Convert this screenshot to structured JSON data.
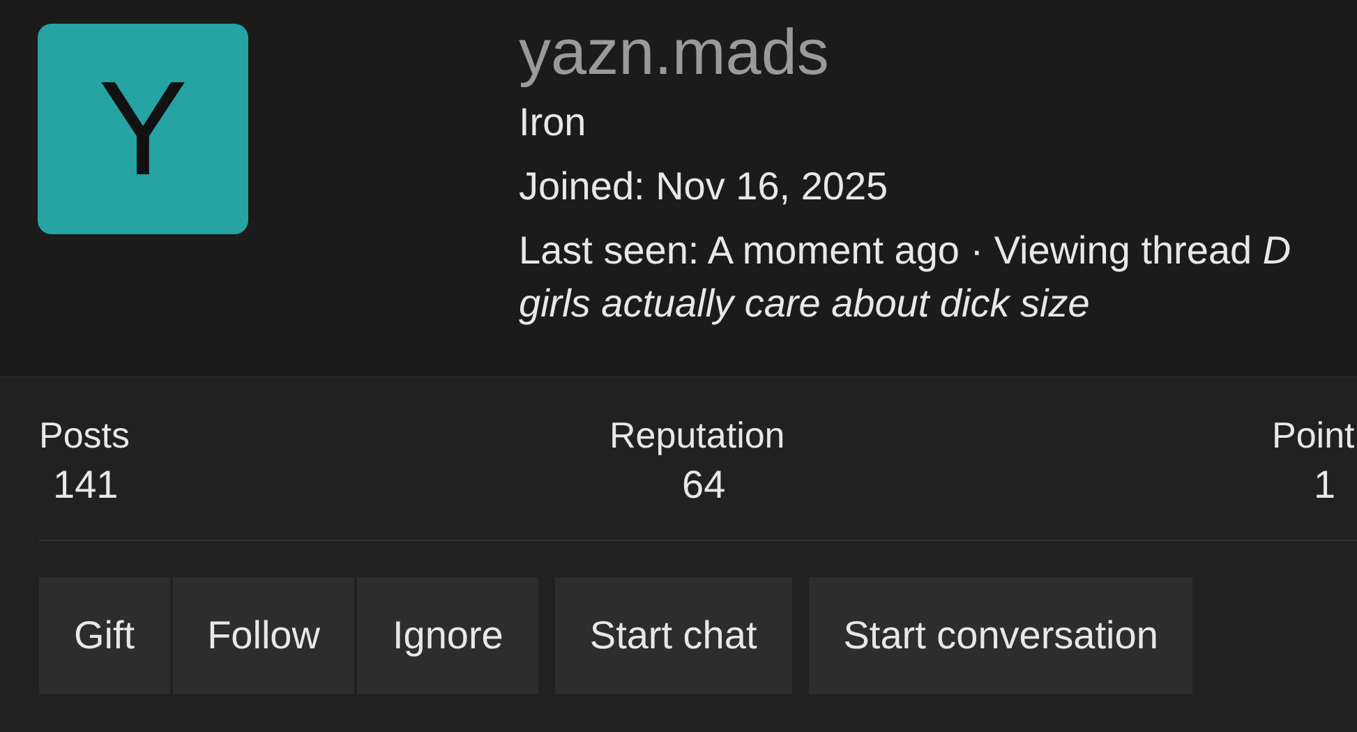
{
  "profile": {
    "avatar_letter": "Y",
    "username": "yazn.mads",
    "rank": "Iron",
    "joined": "Joined: Nov 16, 2025",
    "last_seen": "Last seen: A moment ago · Viewing thread *D*",
    "last_seen_cont": "girls actually care about dick size"
  },
  "stats": [
    {
      "label": "Posts",
      "value": "141"
    },
    {
      "label": "Reputation",
      "value": "64"
    },
    {
      "label": "Point",
      "value": "1"
    }
  ],
  "button_groups": [
    [
      "Gift",
      "Follow",
      "Ignore"
    ],
    [
      "Start chat"
    ],
    [
      "Start conversation"
    ]
  ]
}
